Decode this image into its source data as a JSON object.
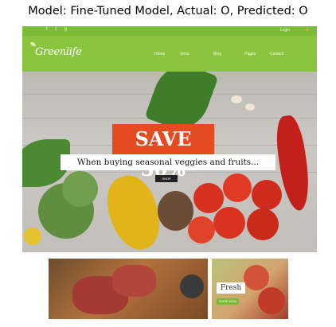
{
  "caption": "Model: Fine-Tuned Model, Actual: O, Predicted: O",
  "site": {
    "logo": "Greenlife",
    "top_bar": {
      "icons": "f t g",
      "login": "Login",
      "cart_icon": "cart-icon"
    },
    "nav": [
      "Home",
      "Shop",
      "Blog",
      "Pages",
      "Contact"
    ],
    "accent_color": "#8bc53f",
    "hero": {
      "badge": "SAVE 30%",
      "tagline": "When buying seasonal veggies and fruits...",
      "button": "SHOP"
    },
    "banners": {
      "fruit_label": "Fresh",
      "fruit_button": "SHOP NOW"
    }
  }
}
